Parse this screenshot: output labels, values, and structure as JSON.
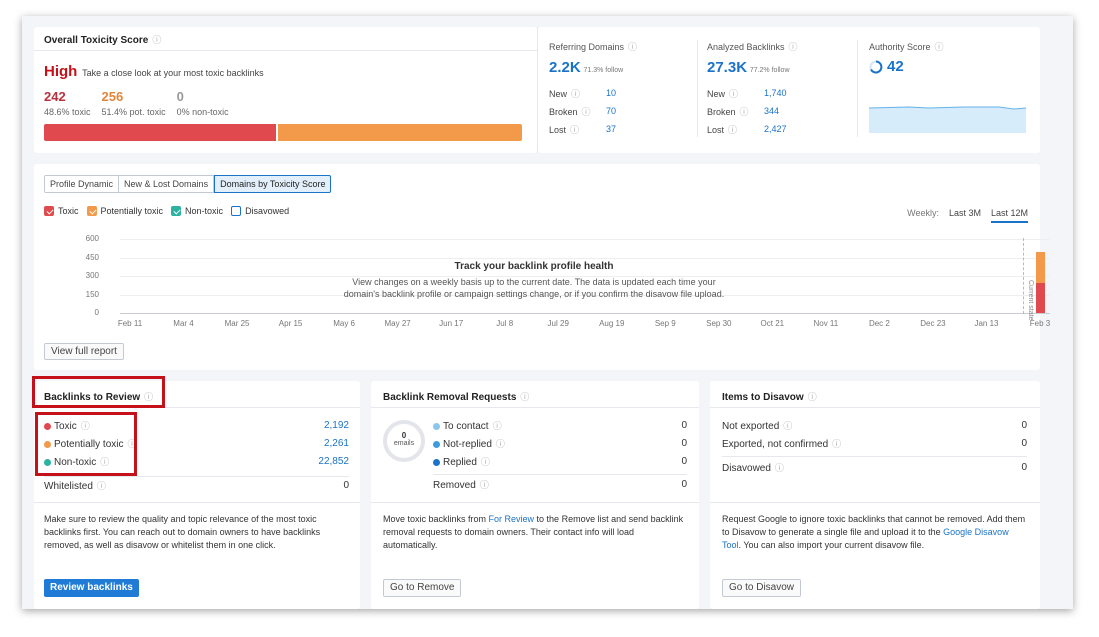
{
  "toxicity": {
    "title": "Overall Toxicity Score",
    "level": "High",
    "level_desc": "Take a close look at your most toxic backlinks",
    "counts": [
      {
        "value": "242",
        "label": "48.6% toxic",
        "color": "#b8313d"
      },
      {
        "value": "256",
        "label": "51.4% pot. toxic",
        "color": "#e0873a"
      },
      {
        "value": "0",
        "label": "0% non-toxic",
        "color": "#999999"
      }
    ],
    "bar": {
      "toxic_share": 0.486,
      "potential_share": 0.514
    }
  },
  "referring": {
    "title": "Referring Domains",
    "value": "2.2K",
    "sub": "71.3% follow",
    "rows": [
      {
        "label": "New",
        "value": "10"
      },
      {
        "label": "Broken",
        "value": "70"
      },
      {
        "label": "Lost",
        "value": "37"
      }
    ]
  },
  "analyzed": {
    "title": "Analyzed Backlinks",
    "value": "27.3K",
    "sub": "77.2% follow",
    "rows": [
      {
        "label": "New",
        "value": "1,740"
      },
      {
        "label": "Broken",
        "value": "344"
      },
      {
        "label": "Lost",
        "value": "2,427"
      }
    ]
  },
  "authority": {
    "title": "Authority Score",
    "value": "42"
  },
  "tabs": [
    "Profile Dynamic",
    "New & Lost Domains",
    "Domains by Toxicity Score"
  ],
  "legend": [
    {
      "label": "Toxic",
      "color": "#e04a4e",
      "checked": true
    },
    {
      "label": "Potentially toxic",
      "color": "#f2994a",
      "checked": true
    },
    {
      "label": "Non-toxic",
      "color": "#2bb39f",
      "checked": true
    },
    {
      "label": "Disavowed",
      "color": "#1a73c9",
      "checked": false
    }
  ],
  "period": {
    "label": "Weekly:",
    "options": [
      "Last 3M",
      "Last 12M"
    ],
    "active": "Last 12M"
  },
  "chart_data": {
    "type": "bar",
    "yticks": [
      "600",
      "450",
      "300",
      "150",
      "0"
    ],
    "ylim": [
      0,
      600
    ],
    "categories": [
      "Feb 11",
      "Mar 4",
      "Mar 25",
      "Apr 15",
      "May 6",
      "May 27",
      "Jun 17",
      "Jul 8",
      "Jul 29",
      "Aug 19",
      "Sep 9",
      "Sep 30",
      "Oct 21",
      "Nov 11",
      "Dec 2",
      "Dec 23",
      "Jan 13",
      "Feb 3"
    ],
    "series": [
      {
        "name": "Toxic",
        "color": "#e04a4e",
        "values": [
          0,
          0,
          0,
          0,
          0,
          0,
          0,
          0,
          0,
          0,
          0,
          0,
          0,
          0,
          0,
          0,
          0,
          242
        ]
      },
      {
        "name": "Potentially toxic",
        "color": "#f2994a",
        "values": [
          0,
          0,
          0,
          0,
          0,
          0,
          0,
          0,
          0,
          0,
          0,
          0,
          0,
          0,
          0,
          0,
          0,
          256
        ]
      }
    ],
    "current_state_label": "Current state"
  },
  "empty_state": {
    "title": "Track your backlink profile health",
    "line1": "View changes on a weekly basis up to the current date. The data is updated each time your",
    "line2": "domain's backlink profile or campaign settings change, or if you confirm the disavow file upload."
  },
  "view_full_report": "View full report",
  "review": {
    "title": "Backlinks to Review",
    "rows": [
      {
        "label": "Toxic",
        "value": "2,192",
        "color": "#e04a4e"
      },
      {
        "label": "Potentially toxic",
        "value": "2,261",
        "color": "#f2994a"
      },
      {
        "label": "Non-toxic",
        "value": "22,852",
        "color": "#2bb39f"
      }
    ],
    "whitelisted": {
      "label": "Whitelisted",
      "value": "0"
    },
    "desc": "Make sure to review the quality and topic relevance of the most toxic backlinks first. You can reach out to domain owners to have backlinks removed, as well as disavow or whitelist them in one click.",
    "button": "Review backlinks"
  },
  "removal": {
    "title": "Backlink Removal Requests",
    "donut_value": "0",
    "donut_label": "emails",
    "rows": [
      {
        "label": "To contact",
        "value": "0",
        "color": "#8ac6ee"
      },
      {
        "label": "Not-replied",
        "value": "0",
        "color": "#3d9be0"
      },
      {
        "label": "Replied",
        "value": "0",
        "color": "#1a73c9"
      }
    ],
    "removed": {
      "label": "Removed",
      "value": "0"
    },
    "desc_pre": "Move toxic backlinks from ",
    "desc_link": "For Review",
    "desc_post": " to the Remove list and send backlink removal requests to domain owners. Their contact info will load automatically.",
    "button": "Go to Remove"
  },
  "disavow": {
    "title": "Items to Disavow",
    "rows": [
      {
        "label": "Not exported",
        "value": "0"
      },
      {
        "label": "Exported, not confirmed",
        "value": "0"
      }
    ],
    "disavowed": {
      "label": "Disavowed",
      "value": "0"
    },
    "desc_pre": "Request Google to ignore toxic backlinks that cannot be removed. Add them to Disavow to generate a single file and upload it to the ",
    "desc_link": "Google Disavow Tool",
    "desc_post": ". You can also import your current disavow file.",
    "button": "Go to Disavow"
  }
}
